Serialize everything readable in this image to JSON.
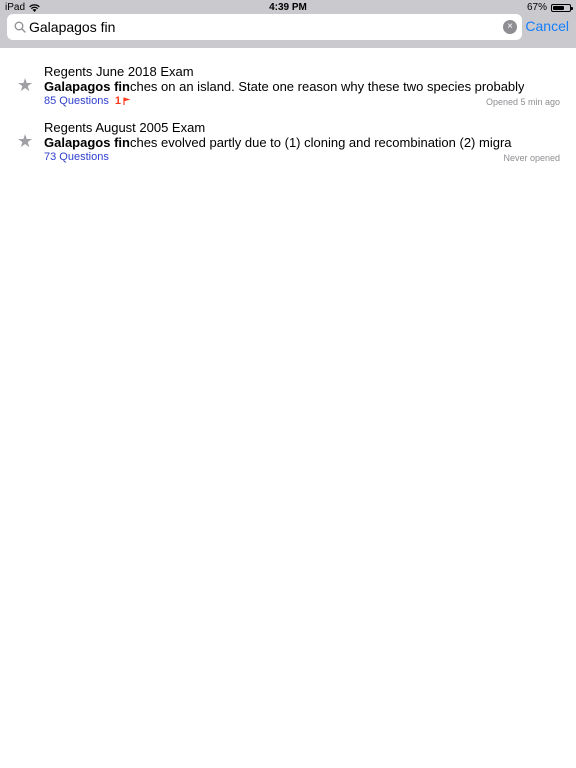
{
  "status_bar": {
    "device": "iPad",
    "time": "4:39 PM",
    "battery": "67%",
    "battery_level": 0.67
  },
  "search": {
    "value": "Galapagos fin",
    "placeholder": "Search",
    "cancel_label": "Cancel",
    "clear_glyph": "×"
  },
  "icons": {
    "search": "search-icon",
    "clear": "clear-icon",
    "star": "star-icon",
    "flag": "flag-icon",
    "wifi": "wifi-icon",
    "battery": "battery-icon"
  },
  "colors": {
    "accent": "#147efb",
    "questions": "#2f3fcf",
    "flag": "#ff3b1f",
    "star": "#a0a0a4",
    "muted": "#8e8e93"
  },
  "results": [
    {
      "exam": "Regents June 2018 Exam",
      "match": "Galapagos fin",
      "snippet_rest": "ches on an island. State one reason why these two species probably",
      "questions": "85 Questions",
      "flag_count": "1",
      "opened": "Opened 5 min ago"
    },
    {
      "exam": "Regents August 2005 Exam",
      "match": "Galapagos fin",
      "snippet_rest": "ches evolved partly due to (1) cloning and recombination (2) migra",
      "questions": "73 Questions",
      "flag_count": "",
      "opened": "Never opened"
    }
  ]
}
